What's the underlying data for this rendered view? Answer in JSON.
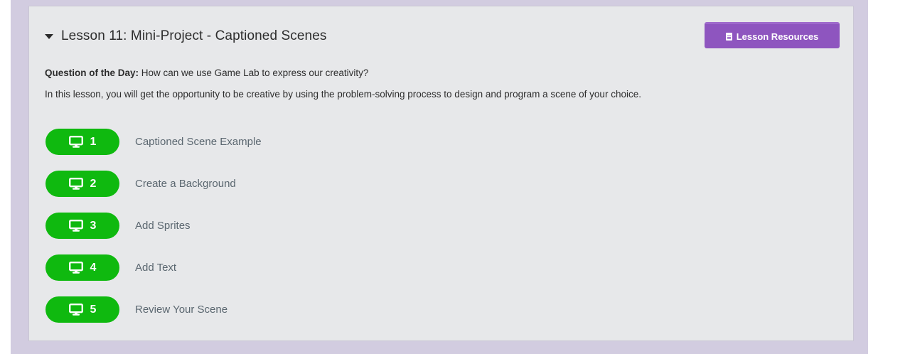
{
  "lesson": {
    "title": "Lesson 11: Mini-Project - Captioned Scenes",
    "resources_label": "Lesson Resources",
    "question_label": "Question of the Day:",
    "question_text": "How can we use Game Lab to express our creativity?",
    "description": "In this lesson, you will get the opportunity to be creative by using the problem-solving process to design and program a scene of your choice."
  },
  "levels": [
    {
      "number": "1",
      "name": "Captioned Scene Example",
      "icon": "monitor-icon"
    },
    {
      "number": "2",
      "name": "Create a Background",
      "icon": "monitor-icon"
    },
    {
      "number": "3",
      "name": "Add Sprites",
      "icon": "monitor-icon"
    },
    {
      "number": "4",
      "name": "Add Text",
      "icon": "monitor-icon"
    },
    {
      "number": "5",
      "name": "Review Your Scene",
      "icon": "monitor-icon"
    }
  ],
  "colors": {
    "page_frame": "#d2cce0",
    "card_bg": "#e7e8ea",
    "resources_button": "#8e55bf",
    "level_bubble": "#0fb90f",
    "level_text": "#5b6770"
  }
}
